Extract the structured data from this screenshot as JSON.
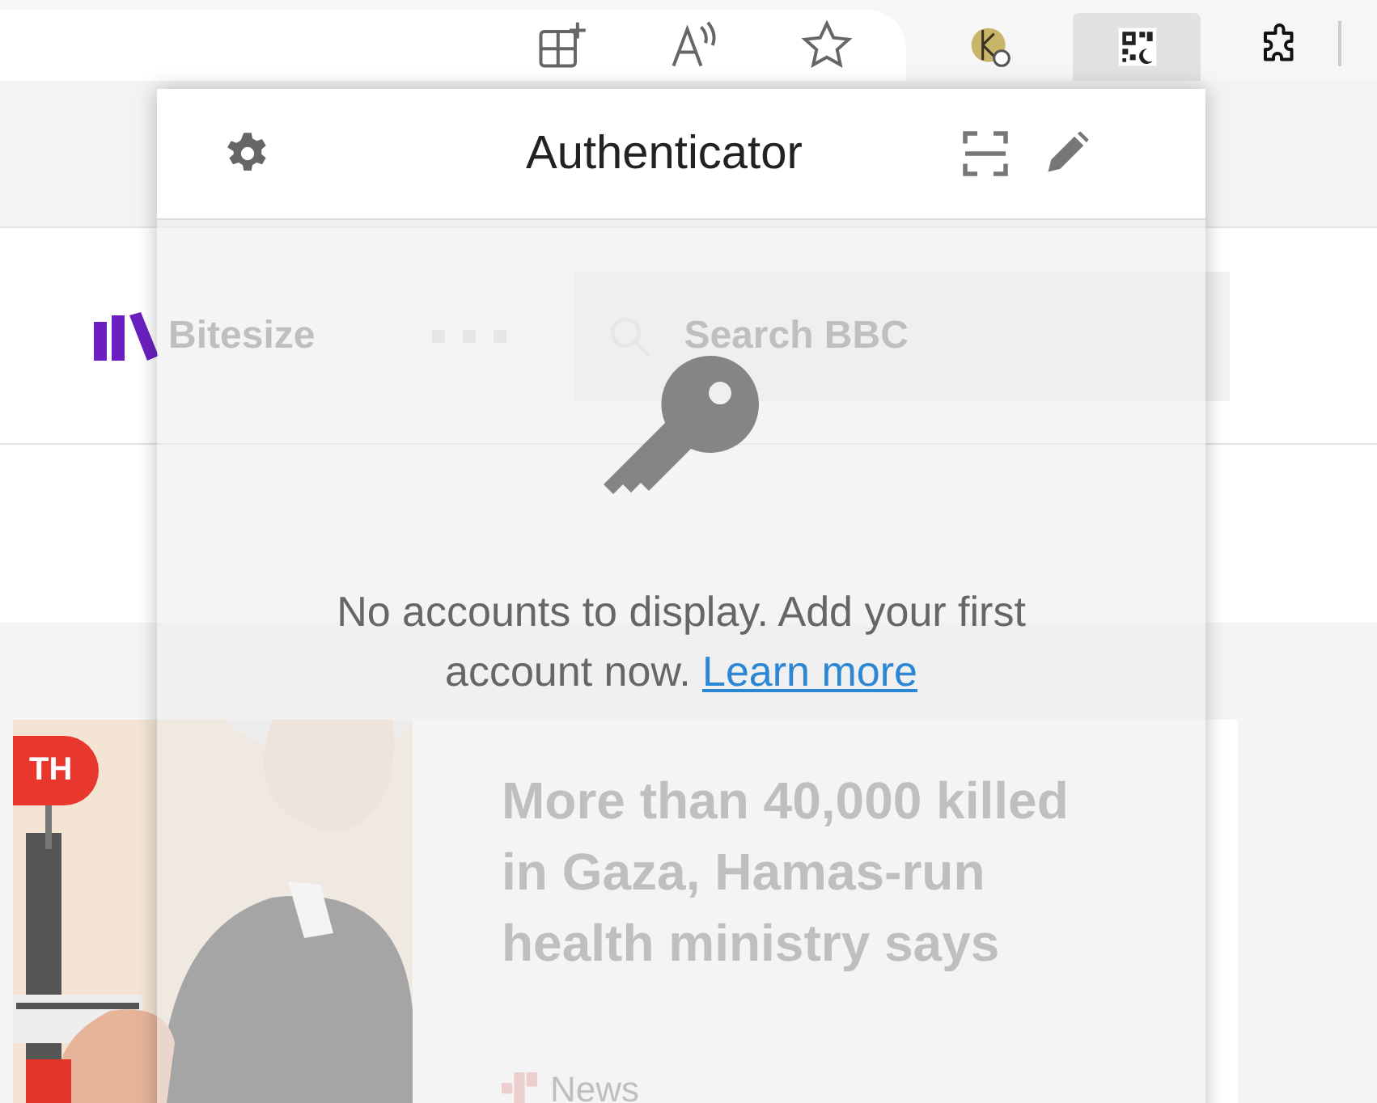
{
  "toolbar": {
    "extensions": [
      {
        "kind": "coin",
        "selected": false
      },
      {
        "kind": "qr",
        "selected": true
      }
    ]
  },
  "page": {
    "nav": {
      "brand": "Bitesize",
      "search_placeholder": "Search BBC"
    },
    "story": {
      "badge": "TH",
      "headline": "More than 40,000 killed in Gaza, Hamas-run health ministry says",
      "source": "News"
    }
  },
  "popup": {
    "title": "Authenticator",
    "message": "No accounts to display. Add your first account now.",
    "link": "Learn more"
  }
}
